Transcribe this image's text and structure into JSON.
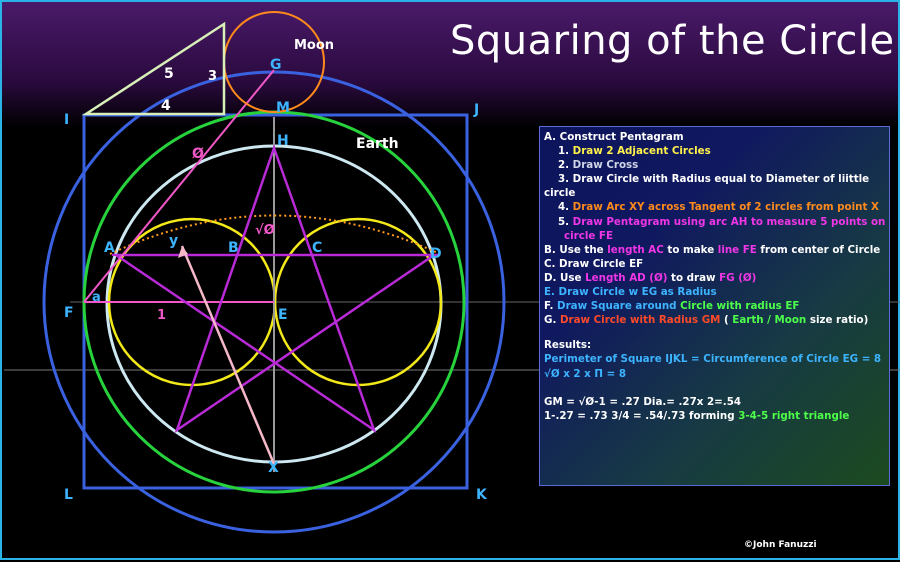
{
  "title": "Squaring of the Circle",
  "copyright": "©John Fanuzzi",
  "colors": {
    "square": "#3a62e0",
    "outer_circle": "#3a62e0",
    "green_circle": "#27d23c",
    "pale_circle": "#cde8f0",
    "small_circles": "#f2e81a",
    "pentagram": "#b82ad6",
    "pink_line": "#f058c8",
    "moon_circle": "#ff8a1c",
    "triangle": "#d8f0b8",
    "dotted_arc": "#ff9a1c",
    "label_cyan": "#3db4ff"
  },
  "labels": {
    "I": "I",
    "J": "J",
    "K": "K",
    "L": "L",
    "A": "A",
    "B": "B",
    "C": "C",
    "D": "D",
    "E": "E",
    "F": "F",
    "G": "G",
    "H": "H",
    "M": "M",
    "X": "X",
    "Y": "y",
    "a": "a",
    "one": "1",
    "phi": "Ø",
    "root_phi": "√Ø",
    "moon": "Moon",
    "earth": "Earth",
    "tri_5": "5",
    "tri_3": "3",
    "tri_4": "4"
  },
  "notes": {
    "A_head": "A. Construct Pentagram",
    "A1_num": "1.",
    "A1_text": "Draw 2 Adjacent Circles",
    "A2_num": "2.",
    "A2_text": "Draw Cross",
    "A3_num": "3.",
    "A3_text": "Draw Circle with Radius equal to Diameter of liittle",
    "A3_text2": "circle",
    "A4_num": "4.",
    "A4_text": "Draw Arc  XY across Tangent of 2 circles from point X",
    "A5_num": "5.",
    "A5_text": "Draw Pentagram using arc AH to measure 5 points on",
    "A5_text2": "circle  FE",
    "B_a": "B. Use the ",
    "B_b": "length AC",
    "B_c": " to make ",
    "B_d": "line FE",
    "B_e": " from center of Circle",
    "C_text": "C. Draw Circle EF",
    "D_a": "D. Use ",
    "D_b": "Length AD (Ø)",
    "D_c": " to draw ",
    "D_d": "FG (Ø)",
    "E_text": "E. Draw Circle w EG as Radius",
    "F_a": "F. ",
    "F_b": "Draw Square around ",
    "F_c": "Circle with radius EF",
    "G_a": "G. ",
    "G_b": "Draw Circle with Radius GM",
    "G_c": "  ( ",
    "G_d": "Earth / Moon",
    "G_e": "  size  ratio)",
    "results_head": "Results:",
    "res1": "Perimeter of Square IJKL = Circumference of Circle EG = 8",
    "res2": "√Ø x 2 x Π = 8",
    "calc1": "GM = √Ø-1 = .27   Dia.= .27x 2=.54",
    "calc2_a": "1-.27 = .73   3/4 = .54/.73  forming ",
    "calc2_b": "3-4-5 right triangle"
  }
}
